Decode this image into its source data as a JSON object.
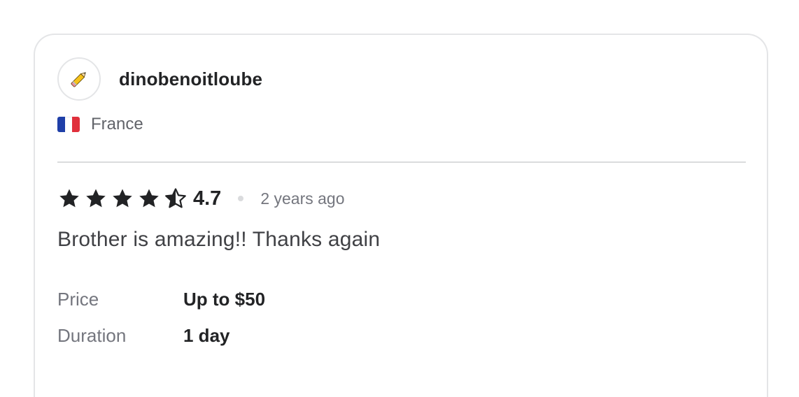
{
  "review": {
    "username": "dinobenoitloube",
    "avatar_icon": "pencil-icon",
    "country": "France",
    "flag_colors": [
      "#1f3fa8",
      "#ffffff",
      "#e0303c"
    ],
    "rating": "4.7",
    "rating_stars": 4.7,
    "time_ago": "2 years ago",
    "text": "Brother is amazing!! Thanks again",
    "price_label": "Price",
    "price_value": "Up to $50",
    "duration_label": "Duration",
    "duration_value": "1 day"
  },
  "colors": {
    "star": "#222325",
    "divider": "#dadbdd",
    "border": "#e4e5e7"
  }
}
